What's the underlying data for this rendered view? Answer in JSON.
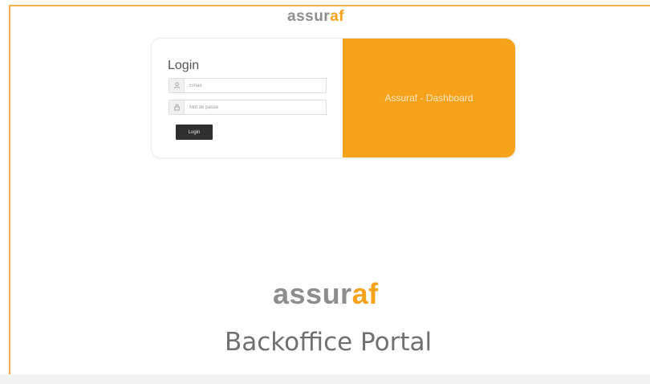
{
  "brand": {
    "logo_part1": "assur",
    "logo_part2": "af",
    "gray": "#8d8d8d",
    "orange": "#f7a21b"
  },
  "login_card": {
    "title": "Login",
    "email": {
      "icon": "user-icon",
      "placeholder": "Email",
      "value": ""
    },
    "password": {
      "icon": "lock-icon",
      "placeholder": "Mot de passe",
      "value": ""
    },
    "submit_label": "Login",
    "panel_text": "Assuraf - Dashboard"
  },
  "footer": {
    "portal_title": "Backoffice Portal"
  },
  "colors": {
    "accent": "#f7a21b",
    "frame_border": "#f5b04a",
    "button_dark": "#2f2f2f"
  }
}
